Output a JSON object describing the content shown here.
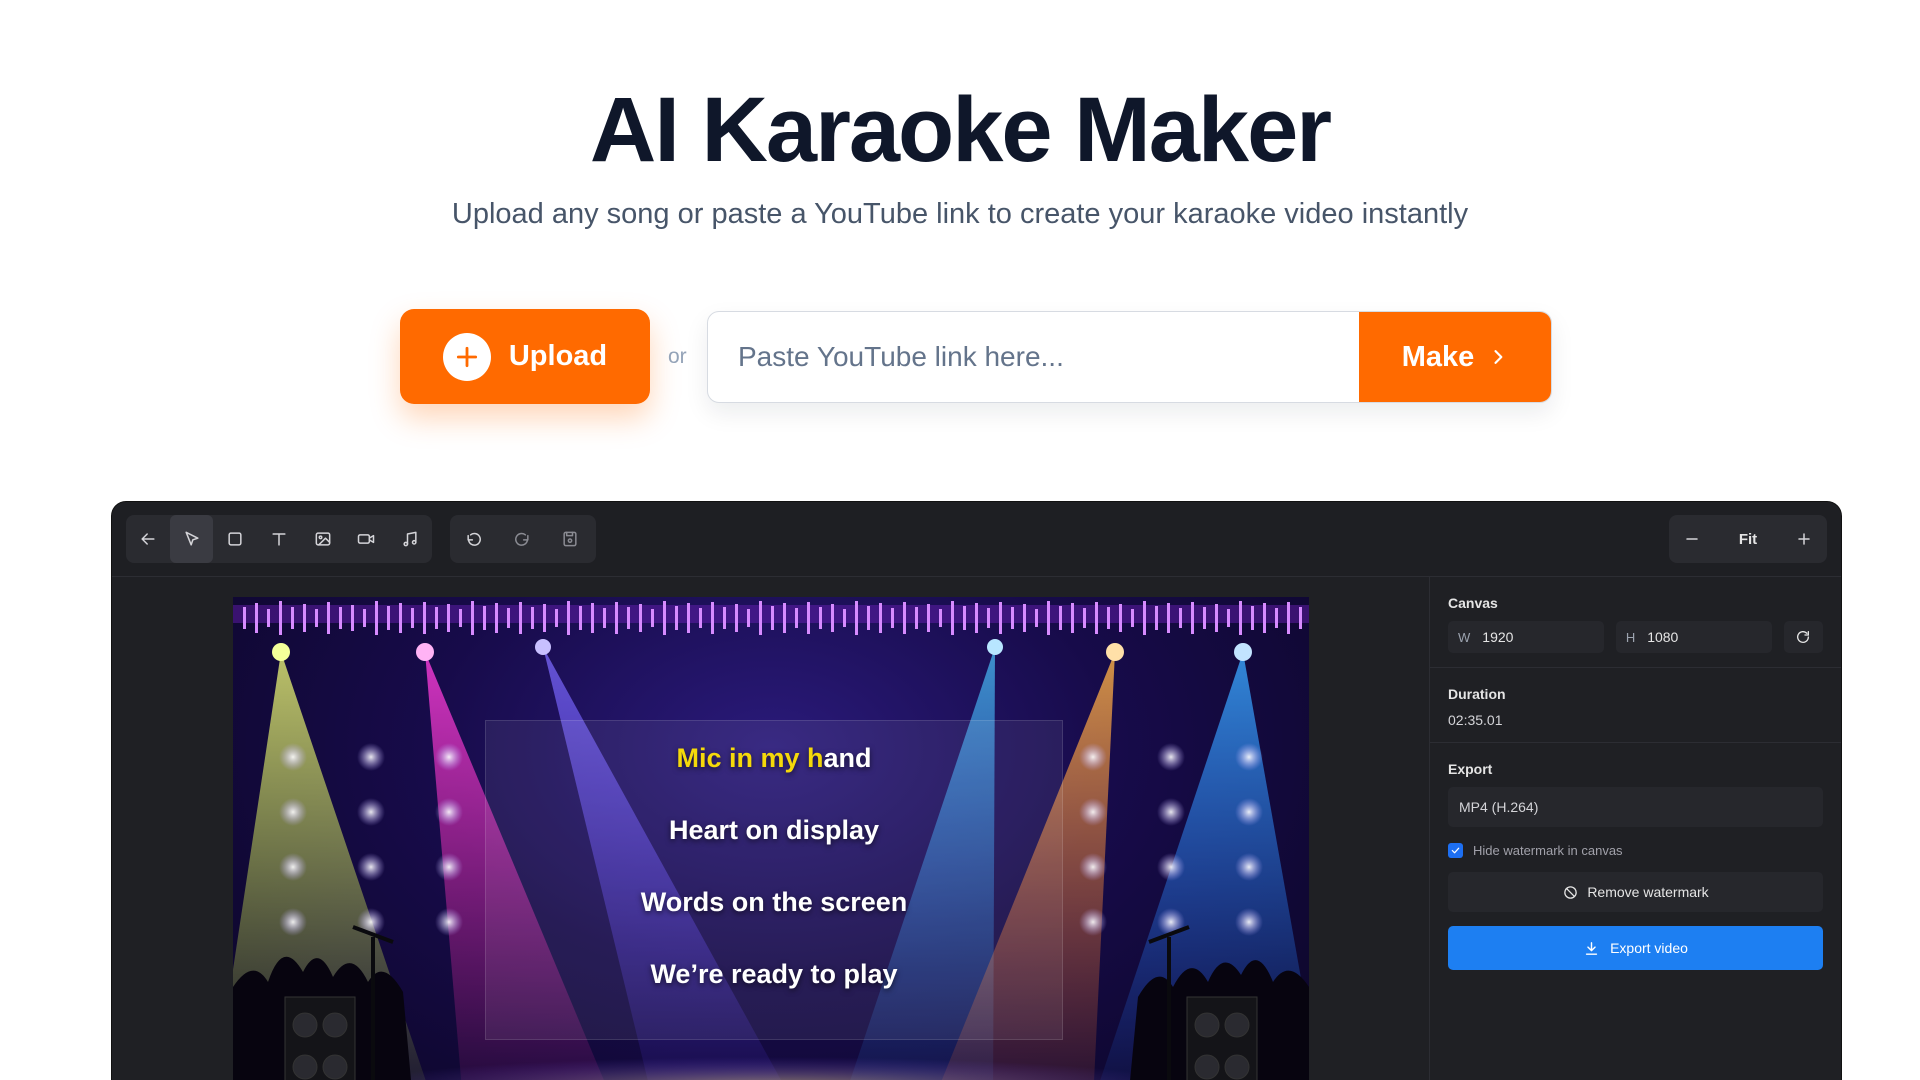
{
  "hero": {
    "title": "AI Karaoke Maker",
    "subtitle": "Upload any song or paste a YouTube link to create your karaoke video instantly"
  },
  "actions": {
    "upload_label": "Upload",
    "or_label": "or",
    "youtube_placeholder": "Paste YouTube link here...",
    "youtube_value": "",
    "make_label": "Make"
  },
  "toolbar": {
    "tools": [
      "back-arrow-icon",
      "select-pointer-icon",
      "rectangle-icon",
      "text-icon",
      "image-icon",
      "video-icon",
      "music-icon"
    ],
    "history": [
      "undo-icon",
      "redo-icon",
      "save-icon"
    ],
    "zoom_label": "Fit"
  },
  "stage": {
    "lyrics": {
      "line1_highlight": "Mic in my h",
      "line1_rest": "and",
      "line2": "Heart on display",
      "line3": "Words on the screen",
      "line4": "We’re ready to play"
    }
  },
  "properties": {
    "canvas_title": "Canvas",
    "width_key": "W",
    "width_value": "1920",
    "height_key": "H",
    "height_value": "1080",
    "duration_title": "Duration",
    "duration_value": "02:35.01",
    "export_title": "Export",
    "export_format": "MP4 (H.264)",
    "hide_watermark_label": "Hide watermark in canvas",
    "hide_watermark_checked": true,
    "remove_watermark_label": "Remove watermark",
    "export_button_label": "Export video"
  },
  "colors": {
    "accent_orange": "#ff6a00",
    "export_blue": "#1d7ff2",
    "lyric_highlight": "#f5d90a",
    "editor_bg": "#1f2024"
  }
}
